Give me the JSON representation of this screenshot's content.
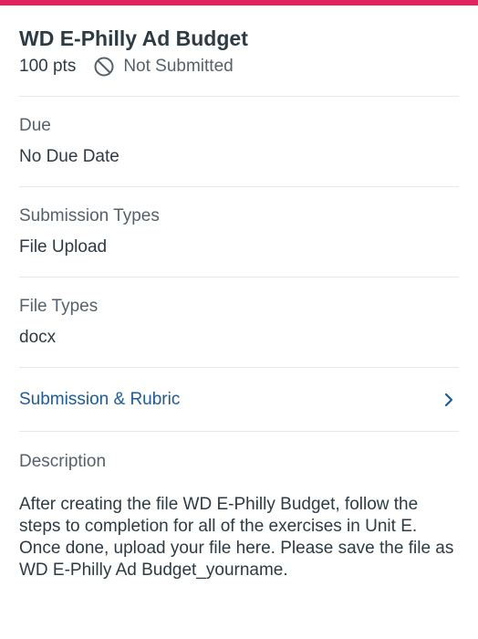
{
  "colors": {
    "accent": "#e0245e",
    "link": "#1e5aa1",
    "text": "#2d3b45",
    "muted": "#56626b"
  },
  "assignment": {
    "title": "WD E-Philly Ad Budget",
    "points": "100 pts",
    "status_icon": "not-submitted-icon",
    "status": "Not Submitted"
  },
  "due": {
    "label": "Due",
    "value": "No Due Date"
  },
  "submission_types": {
    "label": "Submission Types",
    "value": "File Upload"
  },
  "file_types": {
    "label": "File Types",
    "value": "docx"
  },
  "submission_rubric": {
    "label": "Submission & Rubric",
    "icon": "chevron-right-icon"
  },
  "description": {
    "label": "Description",
    "text": "After creating the file WD E-Philly Budget, follow the steps to completion for all of the exercises in Unit E. Once done, upload your file here. Please save the file as WD E-Philly Ad Budget_yourname."
  }
}
